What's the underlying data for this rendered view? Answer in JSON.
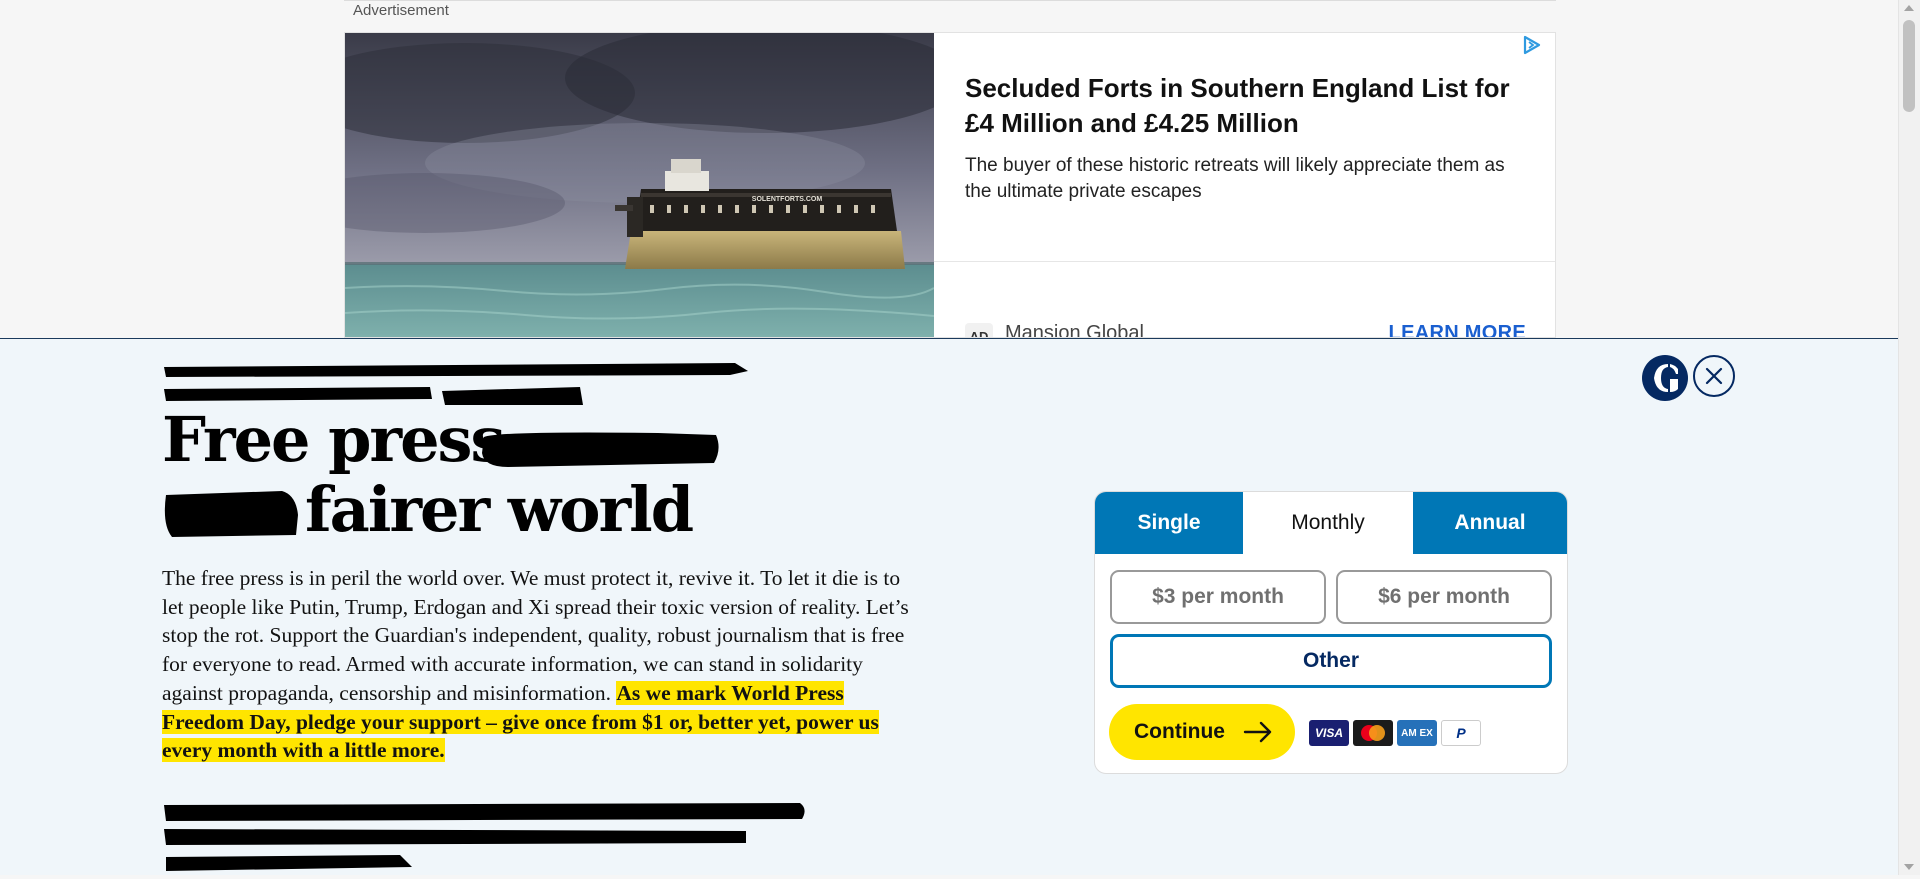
{
  "advertisement": {
    "label": "Advertisement",
    "headline": "Secluded Forts in Southern England List for £4 Million and £4.25 Million",
    "description": "The buyer of these historic retreats will likely appreciate them as the ultimate private escapes",
    "badge": "AD",
    "advertiser": "Mansion Global",
    "cta": "LEARN MORE",
    "image_caption": "SOLENTFORTS.COM",
    "icons": [
      "adchoices-icon"
    ]
  },
  "banner": {
    "headline_line1": "Free press",
    "headline_line2": "fairer world",
    "body": "The free press is in peril the world over. We must protect it, revive it. To let it die is to let people like Putin, Trump, Erdogan and Xi spread their toxic version of reality. Let’s stop the rot. Support the Guardian's independent, quality, robust journalism that is free for everyone to read. Armed with accurate information, we can stand in solidarity against propaganda, censorship and misinformation.",
    "highlight": "As we mark World Press Freedom Day, pledge your support – give once from $1 or, better yet, power us every month with a little more.",
    "icons": [
      "guardian-logo-icon",
      "close-icon"
    ]
  },
  "choice_card": {
    "tabs": [
      "Single",
      "Monthly",
      "Annual"
    ],
    "active_tab": "Monthly",
    "amounts": [
      "$3 per month",
      "$6 per month"
    ],
    "other_label": "Other",
    "continue_label": "Continue",
    "payment_methods": [
      "VISA",
      "Mastercard",
      "AMEX",
      "PayPal"
    ],
    "payment_labels": {
      "visa": "VISA",
      "amex": "AM EX",
      "paypal": "P"
    }
  },
  "colors": {
    "guardian_blue": "#052962",
    "tab_blue": "#0077b6",
    "highlight_yellow": "#ffe500",
    "banner_bg": "#f0f6fa",
    "ad_link": "#1a5fd0"
  }
}
